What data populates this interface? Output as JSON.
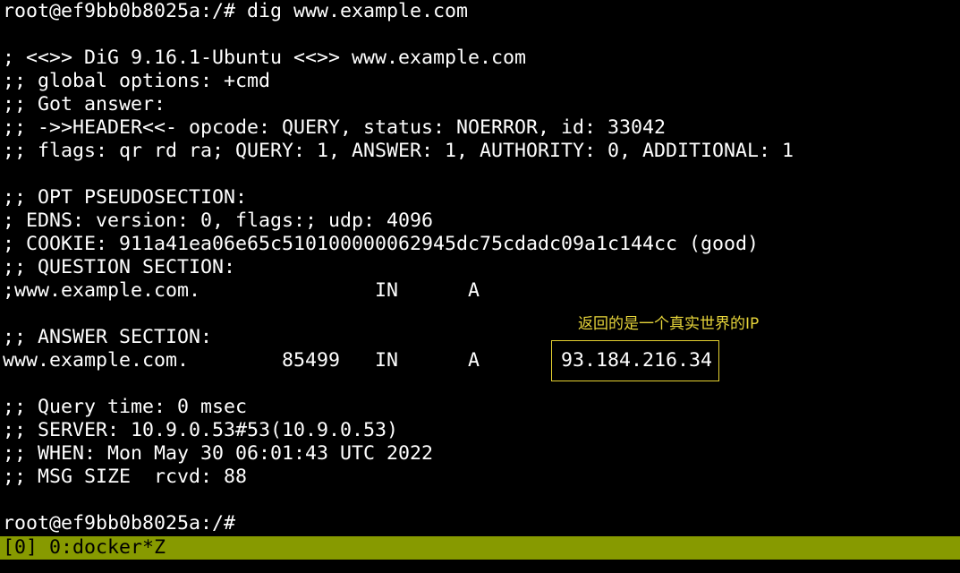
{
  "terminal": {
    "lines": [
      "root@ef9bb0b8025a:/# dig www.example.com",
      "",
      "; <<>> DiG 9.16.1-Ubuntu <<>> www.example.com",
      ";; global options: +cmd",
      ";; Got answer:",
      ";; ->>HEADER<<- opcode: QUERY, status: NOERROR, id: 33042",
      ";; flags: qr rd ra; QUERY: 1, ANSWER: 1, AUTHORITY: 0, ADDITIONAL: 1",
      "",
      ";; OPT PSEUDOSECTION:",
      "; EDNS: version: 0, flags:; udp: 4096",
      "; COOKIE: 911a41ea06e65c510100000062945dc75cdadc09a1c144cc (good)",
      ";; QUESTION SECTION:",
      ";www.example.com.               IN      A",
      "",
      ";; ANSWER SECTION:",
      "www.example.com.        85499   IN      A       93.184.216.34",
      "",
      ";; Query time: 0 msec",
      ";; SERVER: 10.9.0.53#53(10.9.0.53)",
      ";; WHEN: Mon May 30 06:01:43 UTC 2022",
      ";; MSG SIZE  rcvd: 88",
      "",
      "root@ef9bb0b8025a:/#"
    ]
  },
  "annotation": {
    "text": "返回的是一个真实世界的IP"
  },
  "status_bar": {
    "text": "[0] 0:docker*Z"
  },
  "colors": {
    "background": "#000000",
    "foreground": "#ffffff",
    "annotation": "#e6d43a",
    "highlight_border": "#e5d130",
    "status_bar_bg": "#879a00",
    "status_bar_fg": "#000000"
  }
}
